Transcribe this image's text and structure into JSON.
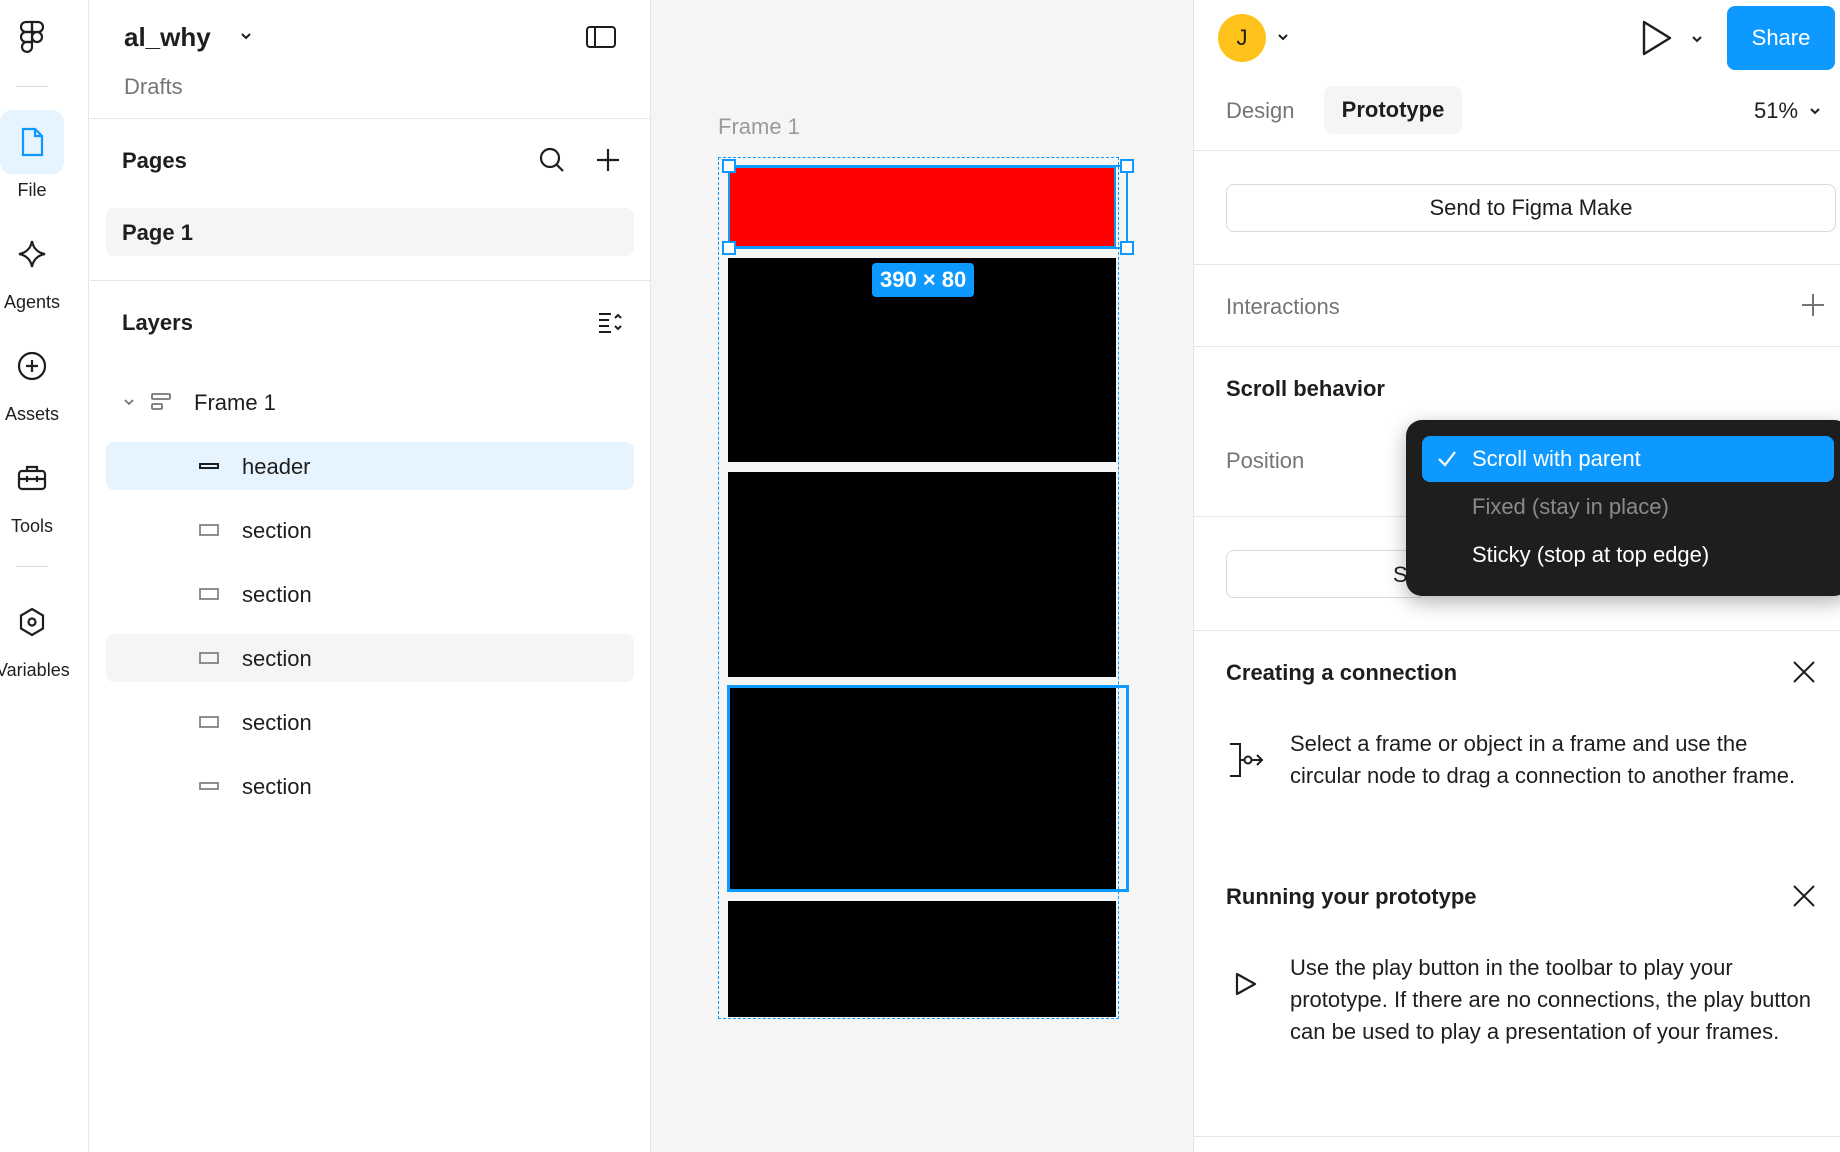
{
  "file": {
    "name": "al_why",
    "location": "Drafts"
  },
  "rail": {
    "items": [
      {
        "label": "File",
        "icon": "file-icon"
      },
      {
        "label": "Agents",
        "icon": "sparkle-icon"
      },
      {
        "label": "Assets",
        "icon": "plus-circle-icon"
      },
      {
        "label": "Tools",
        "icon": "toolbox-icon"
      },
      {
        "label": "Variables",
        "icon": "hexagon-icon"
      }
    ]
  },
  "pages": {
    "title": "Pages",
    "items": [
      "Page 1"
    ]
  },
  "layers": {
    "title": "Layers",
    "frame": "Frame 1",
    "children": [
      "header",
      "section",
      "section",
      "section",
      "section",
      "section"
    ]
  },
  "canvas": {
    "frame_label": "Frame 1",
    "size_badge": "390 × 80",
    "colors": {
      "header": "#ff0000",
      "section": "#000000",
      "selection": "#0d99ff"
    }
  },
  "toolbar": {
    "avatar_initial": "J",
    "share_label": "Share",
    "zoom": "51%"
  },
  "tabs": {
    "design": "Design",
    "prototype": "Prototype"
  },
  "prototype": {
    "send_button": "Send to Figma Make",
    "interactions_title": "Interactions",
    "scroll_title": "Scroll behavior",
    "position_label": "Position",
    "partial_button_text": "S",
    "dropdown": [
      {
        "label": "Scroll with parent",
        "selected": true,
        "disabled": false
      },
      {
        "label": "Fixed (stay in place)",
        "selected": false,
        "disabled": true
      },
      {
        "label": "Sticky (stop at top edge)",
        "selected": false,
        "disabled": false
      }
    ],
    "connection": {
      "title": "Creating a connection",
      "body": "Select a frame or object in a frame and use the circular node to drag a connection to another frame."
    },
    "running": {
      "title": "Running your prototype",
      "body": "Use the play button in the toolbar to play your prototype. If there are no connections, the play button can be used to play a presentation of your frames."
    }
  },
  "accent": "#0d99ff"
}
